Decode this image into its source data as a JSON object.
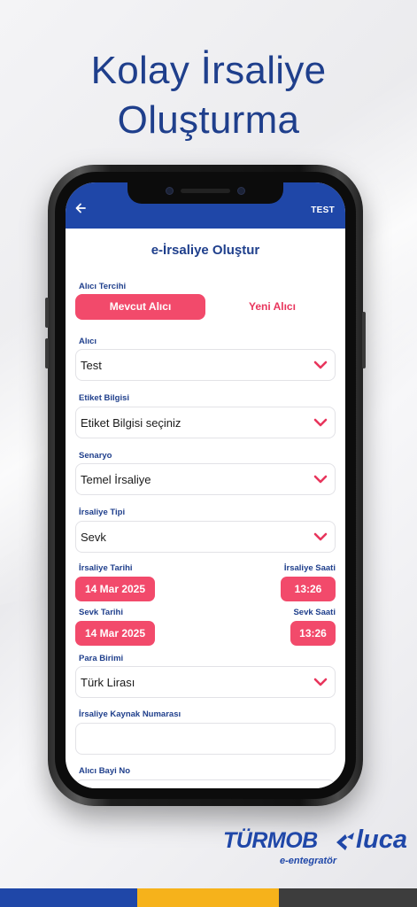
{
  "headline": {
    "line1": "Kolay İrsaliye",
    "line2": "Oluşturma"
  },
  "appbar": {
    "back_icon": "arrow-left-icon",
    "right_label": "TEST"
  },
  "form": {
    "title": "e-İrsaliye Oluştur",
    "recipient_pref": {
      "label": "Alıcı Tercihi",
      "active": "Mevcut Alıcı",
      "inactive": "Yeni Alıcı"
    },
    "recipient": {
      "label": "Alıcı",
      "value": "Test"
    },
    "tag_info": {
      "label": "Etiket Bilgisi",
      "value": "Etiket Bilgisi seçiniz"
    },
    "scenario": {
      "label": "Senaryo",
      "value": "Temel İrsaliye"
    },
    "waybill_type": {
      "label": "İrsaliye Tipi",
      "value": "Sevk"
    },
    "waybill_date": {
      "label": "İrsaliye Tarihi",
      "value": "14 Mar 2025"
    },
    "waybill_time": {
      "label": "İrsaliye Saati",
      "value": "13:26"
    },
    "ship_date": {
      "label": "Sevk Tarihi",
      "value": "14 Mar 2025"
    },
    "ship_time": {
      "label": "Sevk Saati",
      "value": "13:26"
    },
    "currency": {
      "label": "Para Birimi",
      "value": "Türk Lirası"
    },
    "source_number": {
      "label": "İrsaliye Kaynak Numarası",
      "value": ""
    },
    "dealer_no": {
      "label": "Alıcı Bayi No"
    }
  },
  "brand": {
    "name_left": "TÜRMOB",
    "name_right": "luca",
    "subtitle": "e-entegratör"
  },
  "colors": {
    "primary_blue": "#1f47a8",
    "heading_blue": "#1f3f8c",
    "accent_pink": "#f24a6b",
    "stripe_blue": "#1f47a8",
    "stripe_yellow": "#f6b21b",
    "stripe_gray": "#3d3d3d"
  }
}
